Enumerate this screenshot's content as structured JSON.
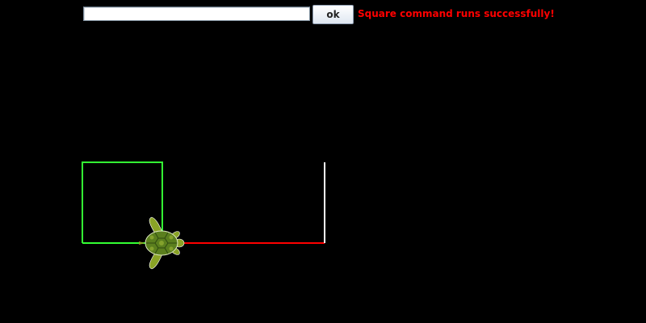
{
  "command_bar": {
    "input_value": "",
    "ok_label": "ok",
    "status_message": "Square command runs successfully!",
    "status_color": "#ff0000"
  },
  "drawing": {
    "background": "#000000",
    "path_colors": [
      "#00ff00",
      "#ff0000",
      "#ffffff"
    ],
    "turtle_icon": "sea-turtle-icon"
  }
}
